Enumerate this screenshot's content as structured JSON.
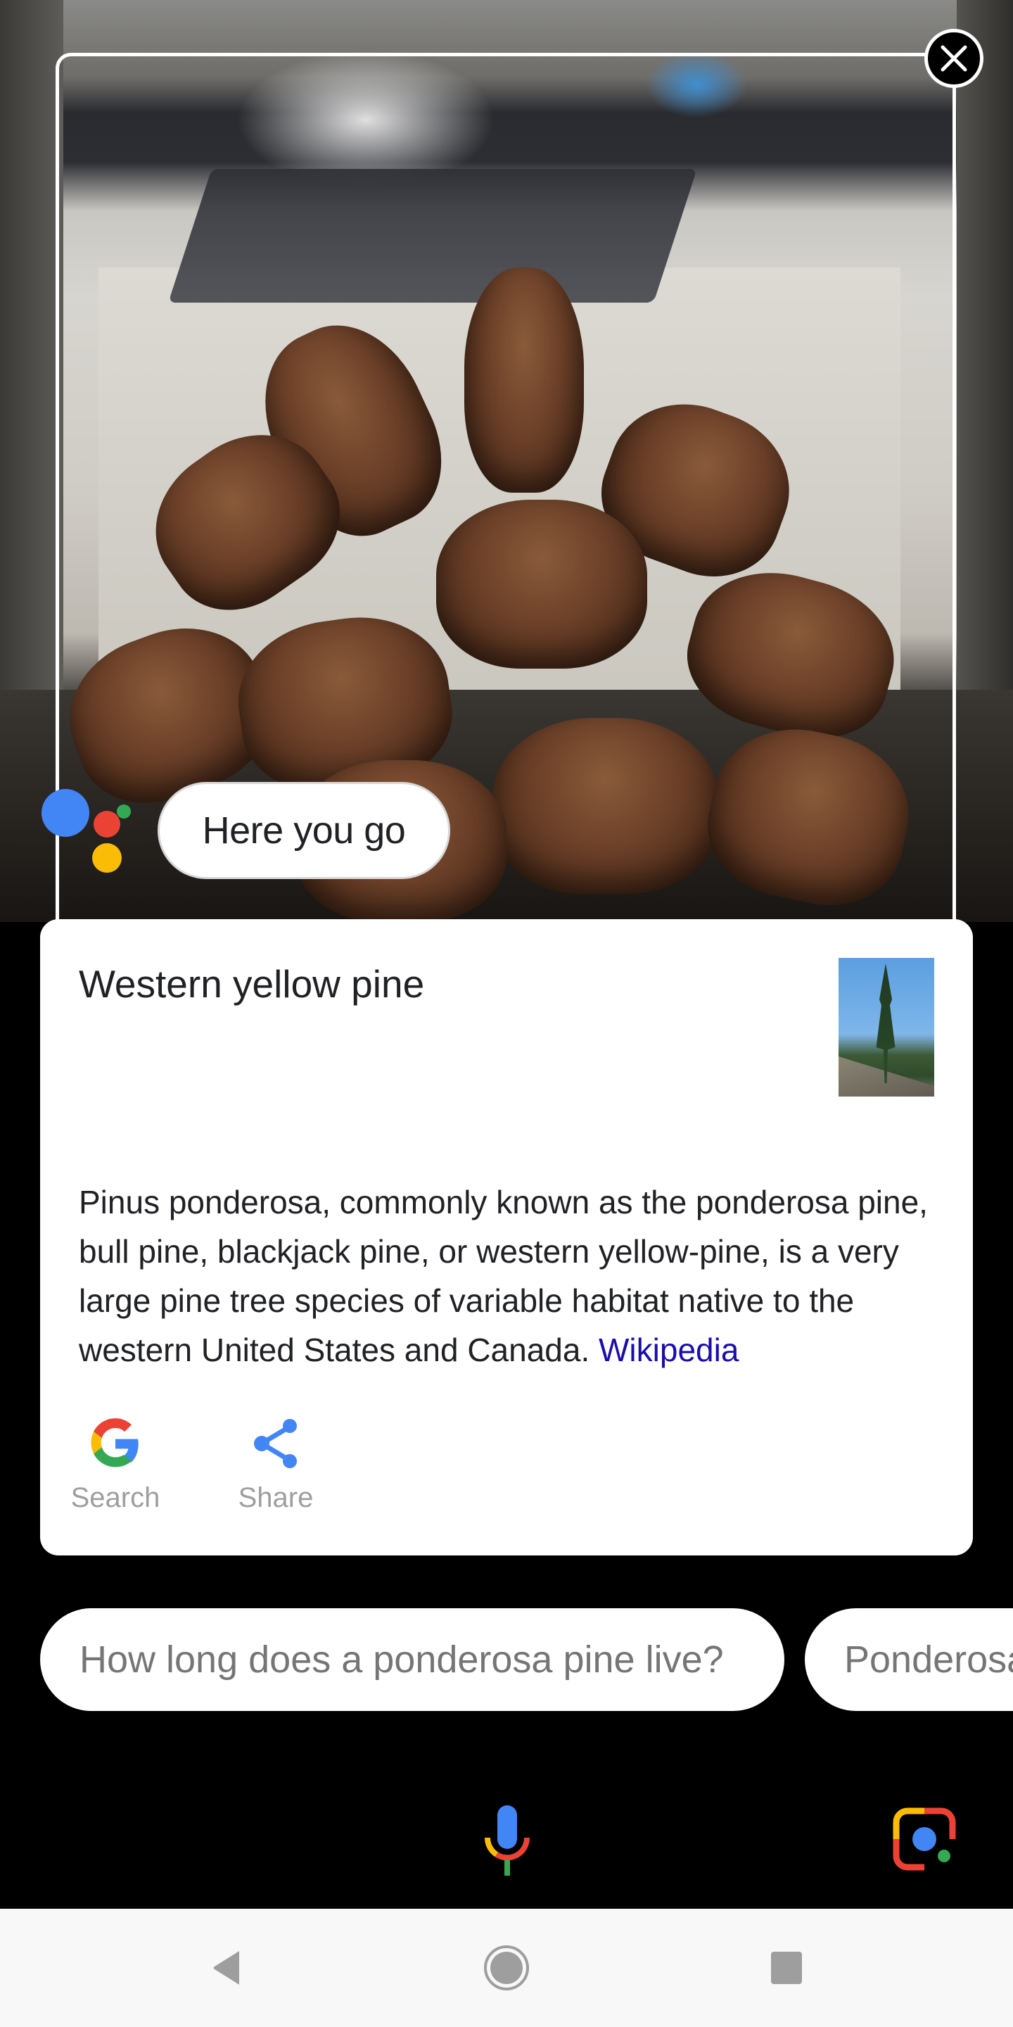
{
  "assistant": {
    "response_bubble": "Here you go",
    "colors": {
      "blue": "#4285f4",
      "red": "#ea4335",
      "green": "#34a853",
      "yellow": "#fbbc05"
    }
  },
  "overlay": {
    "close_icon": "close-icon"
  },
  "card": {
    "title": "Western yellow pine",
    "thumbnail_alt": "Ponderosa pine tree",
    "description": "Pinus ponderosa, commonly known as the ponderosa pine, bull pine, blackjack pine, or western yellow-pine, is a very large pine tree species of variable habitat native to the western United States and Canada.",
    "source_link": "Wikipedia",
    "link_color": "#1a0dab",
    "actions": [
      {
        "label": "Search",
        "icon": "google-g-icon"
      },
      {
        "label": "Share",
        "icon": "share-icon"
      }
    ]
  },
  "suggestions": [
    "How long does a ponderosa pine live?",
    "Ponderosa"
  ],
  "bottom_bar": {
    "mic_icon": "microphone-icon",
    "lens_icon": "google-lens-icon"
  },
  "navigation": {
    "back": "back-icon",
    "home": "home-icon",
    "recents": "recents-icon"
  }
}
